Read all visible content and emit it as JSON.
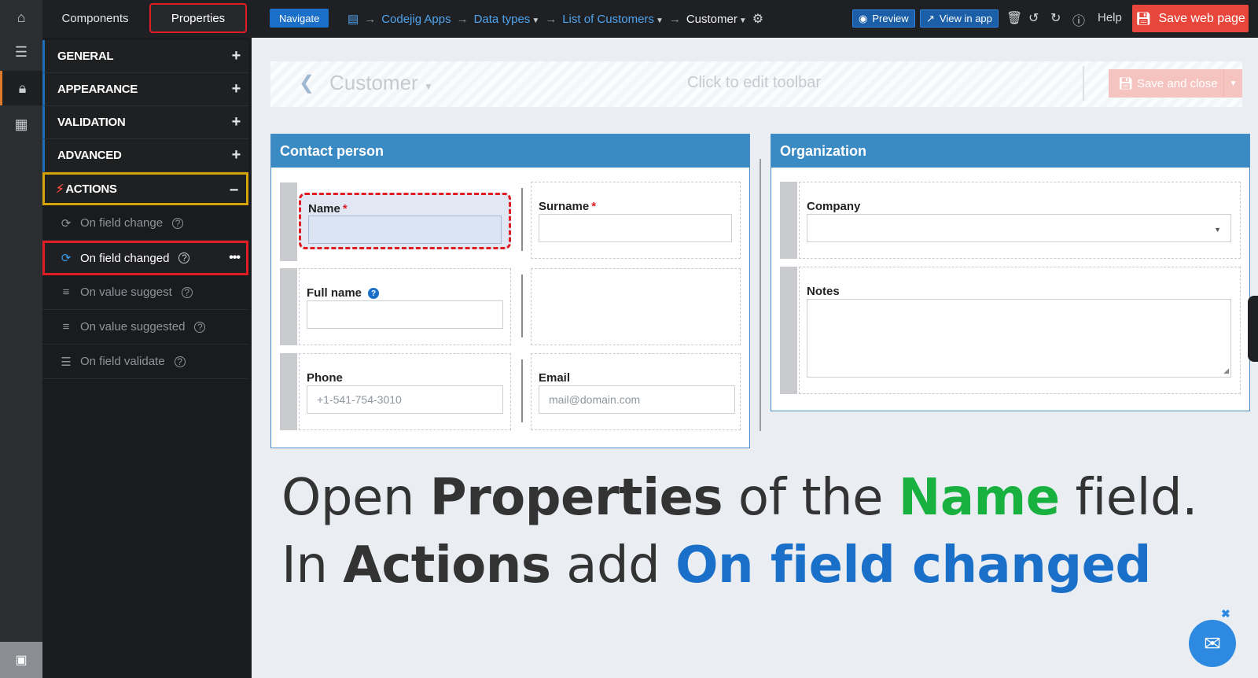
{
  "topbar": {
    "tab_components": "Components",
    "tab_properties": "Properties",
    "navigate_label": "Navigate",
    "breadcrumb": [
      {
        "label": "Codejig Apps"
      },
      {
        "label": "Data types"
      },
      {
        "label": "List of Customers"
      },
      {
        "label": "Customer"
      }
    ],
    "preview_label": "Preview",
    "view_in_app_label": "View in app",
    "help_label": "Help",
    "save_label": "Save web page"
  },
  "sidebar": {
    "sections": [
      {
        "label": "GENERAL",
        "toggle": "+"
      },
      {
        "label": "APPEARANCE",
        "toggle": "+"
      },
      {
        "label": "VALIDATION",
        "toggle": "+"
      },
      {
        "label": "ADVANCED",
        "toggle": "+"
      }
    ],
    "actions_section": {
      "label": "ACTIONS",
      "toggle": "−"
    },
    "actions": [
      {
        "label": "On field change",
        "icon": "refresh-icon"
      },
      {
        "label": "On field changed",
        "icon": "refresh-icon",
        "selected": true
      },
      {
        "label": "On value suggest",
        "icon": "lines-icon"
      },
      {
        "label": "On value suggested",
        "icon": "lines-icon"
      },
      {
        "label": "On field validate",
        "icon": "list-check-icon"
      }
    ]
  },
  "form_toolbar": {
    "title": "Customer",
    "hint": "Click to edit toolbar",
    "save_close_label": "Save and close"
  },
  "contact_panel": {
    "title": "Contact person",
    "name_label": "Name",
    "surname_label": "Surname",
    "full_name_label": "Full name",
    "phone_label": "Phone",
    "phone_placeholder": "+1-541-754-3010",
    "email_label": "Email",
    "email_placeholder": "mail@domain.com"
  },
  "org_panel": {
    "title": "Organization",
    "company_label": "Company",
    "notes_label": "Notes"
  },
  "caption": {
    "line1": {
      "pre": "Open ",
      "bold": "Properties",
      "mid": " of the ",
      "green": "Name",
      "post": " field."
    },
    "line2": {
      "pre": "In ",
      "bold": "Actions",
      "mid": " add ",
      "blue": "On field changed"
    }
  },
  "colors": {
    "accent": "#1a6fc9",
    "save": "#e8463b",
    "highlight_red": "#e01d25",
    "highlight_gold": "#d4a20a",
    "caption_green": "#18b13f"
  }
}
